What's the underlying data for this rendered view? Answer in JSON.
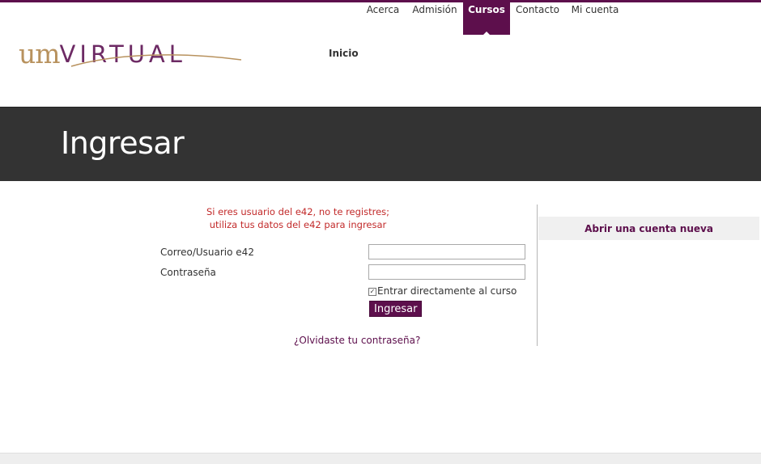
{
  "brand": {
    "logo_part1": "UM",
    "logo_part2": "VIRTUAL"
  },
  "topnav": {
    "items": [
      {
        "label": "Acerca"
      },
      {
        "label": "Admisión"
      },
      {
        "label": "Cursos",
        "active": true
      },
      {
        "label": "Contacto"
      },
      {
        "label": "Mi cuenta"
      }
    ]
  },
  "subnav": {
    "inicio": "Inicio"
  },
  "banner": {
    "title": "Ingresar"
  },
  "login": {
    "notice_line1": "Si eres usuario del e42, no te registres;",
    "notice_line2": "utiliza tus datos del e42 para ingresar",
    "username_label": "Correo/Usuario e42",
    "username_value": "",
    "password_label": "Contraseña",
    "password_value": "",
    "remember_label": "Entrar directamente al curso",
    "remember_checked": true,
    "submit_label": "Ingresar",
    "forgot_label": "¿Olvidaste tu contraseña?"
  },
  "signup": {
    "label": "Abrir una cuenta nueva"
  },
  "colors": {
    "brand_purple": "#5d0f4c",
    "logo_gold": "#b8925e",
    "banner_bg": "#333333",
    "notice_red": "#c22a2a"
  }
}
